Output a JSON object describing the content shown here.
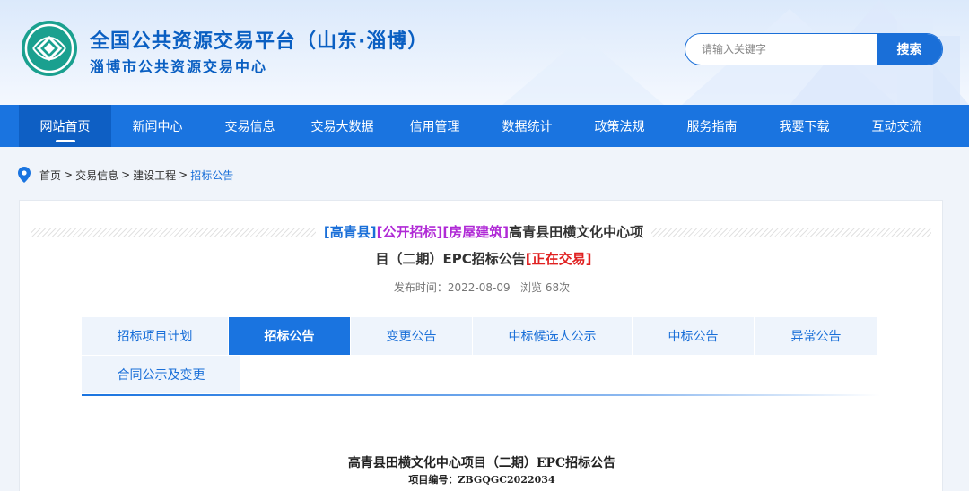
{
  "header": {
    "title_main": "全国公共资源交易平台（山东·淄博）",
    "title_sub": "淄博市公共资源交易中心",
    "search_placeholder": "请输入关键字",
    "search_button": "搜索"
  },
  "nav": {
    "items": [
      {
        "label": "网站首页",
        "active": true
      },
      {
        "label": "新闻中心"
      },
      {
        "label": "交易信息"
      },
      {
        "label": "交易大数据"
      },
      {
        "label": "信用管理"
      },
      {
        "label": "数据统计"
      },
      {
        "label": "政策法规"
      },
      {
        "label": "服务指南"
      },
      {
        "label": "我要下载"
      },
      {
        "label": "互动交流"
      }
    ]
  },
  "breadcrumb": {
    "home": "首页",
    "level1": "交易信息",
    "level2": "建设工程",
    "current": "招标公告",
    "separator": ">"
  },
  "notice": {
    "tag_county": "[高青县]",
    "tag_method": "[公开招标]",
    "tag_category": "[房屋建筑]",
    "title_part1": "高青县田横文化中心项",
    "title_part2": "目（二期）EPC招标公告",
    "status": "[正在交易]",
    "publish_label": "发布时间：",
    "publish_date": "2022-08-09",
    "views_label": "浏览",
    "views_count": "68次"
  },
  "tabs": {
    "items": [
      {
        "label": "招标项目计划"
      },
      {
        "label": "招标公告",
        "active": true
      },
      {
        "label": "变更公告"
      },
      {
        "label": "中标候选人公示"
      },
      {
        "label": "中标公告"
      },
      {
        "label": "异常公告"
      },
      {
        "label": "合同公示及变更"
      }
    ]
  },
  "document": {
    "title": "高青县田横文化中心项目（二期）EPC招标公告",
    "code_label": "项目编号：",
    "code": "ZBGQGC2022034"
  },
  "colors": {
    "brand_blue": "#1a74e0",
    "active_nav": "#0e5fc4",
    "tag_purple": "#b02ad6",
    "tag_red": "#e02020"
  }
}
